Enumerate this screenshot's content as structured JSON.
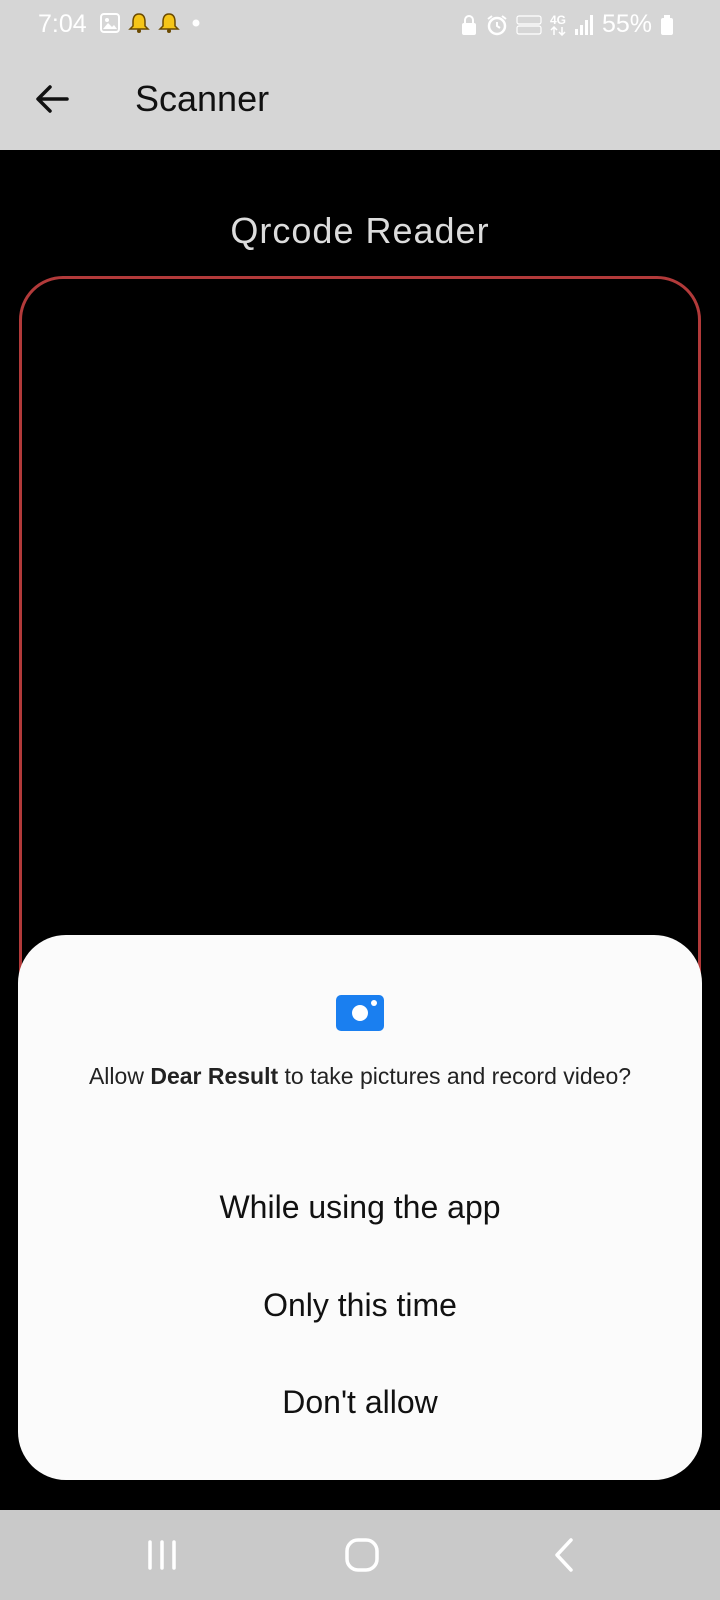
{
  "status_bar": {
    "time": "7:04",
    "battery_percent": "55%",
    "network_label": "4G",
    "left_icons": [
      "gallery-icon",
      "bell-icon",
      "bell-icon",
      "dot-icon"
    ],
    "right_icons": [
      "lock-icon",
      "alarm-icon",
      "volte-icon",
      "network-4g-icon",
      "signal-icon",
      "battery-icon"
    ]
  },
  "app_bar": {
    "title": "Scanner",
    "back_icon": "arrow-back-icon"
  },
  "scanner": {
    "title": "Qrcode Reader",
    "frame_color": "#b23a3a"
  },
  "permission_dialog": {
    "message_prefix": "Allow ",
    "app_name": "Dear Result",
    "message_suffix": " to take pictures and record video?",
    "icon": "camera-icon",
    "accent_color": "#1a7ff0",
    "options": [
      {
        "label": "While using the app"
      },
      {
        "label": "Only this time"
      },
      {
        "label": "Don't allow"
      }
    ]
  },
  "nav_bar": {
    "buttons": [
      "recents-icon",
      "home-icon",
      "back-icon"
    ]
  }
}
